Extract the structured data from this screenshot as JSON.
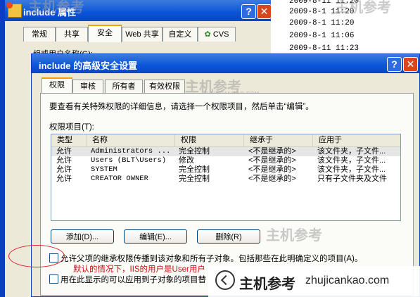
{
  "background_list": {
    "rows": [
      "2009-8-11 11:20",
      "2009-8-1 11:20",
      "2009-8-1 11:20",
      "2009-8-1 11:06",
      "2009-8-11 11:23"
    ]
  },
  "back_window": {
    "title": "include 属性",
    "tabs": [
      "常规",
      "共享",
      "安全",
      "Web 共享",
      "自定义",
      "CVS"
    ],
    "active_tab": "安全",
    "partial_label": "组或用户名称(G):",
    "partial_bottom": "U"
  },
  "front_window": {
    "title": "include 的高级安全设置",
    "tabs": [
      "权限",
      "审核",
      "所有者",
      "有效权限"
    ],
    "active_tab": "权限",
    "description": "要查看有关特殊权限的详细信息，请选择一个权限项目，然后单击“编辑”。",
    "list_label": "权限项目(T):",
    "columns": [
      "类型",
      "名称",
      "权限",
      "继承于",
      "应用于"
    ],
    "rows": [
      {
        "type": "允许",
        "name": "Administrators ...",
        "perm": "完全控制",
        "inherit": "<不是继承的>",
        "apply": "该文件夹，子文件..."
      },
      {
        "type": "允许",
        "name": "Users (BLT\\Users)",
        "perm": "修改",
        "inherit": "<不是继承的>",
        "apply": "该文件夹，子文件..."
      },
      {
        "type": "允许",
        "name": "SYSTEM",
        "perm": "完全控制",
        "inherit": "<不是继承的>",
        "apply": "该文件夹，子文件..."
      },
      {
        "type": "允许",
        "name": "CREATOR OWNER",
        "perm": "完全控制",
        "inherit": "<不是继承的>",
        "apply": "只有子文件夹及文件"
      }
    ],
    "buttons": {
      "add": "添加(D)...",
      "edit": "编辑(E)...",
      "remove": "删除(R)"
    },
    "checkbox_inherit": "允许父项的继承权限传播到该对象和所有子对象。包括那些在此明确定义的项目(A)。",
    "annotation": "默认的情况下，IIS的用户是User用户",
    "checkbox_apply": "用在此显示的可以应用到子对象的项目替"
  },
  "watermark": {
    "zh": "主机参考",
    "en": "zhujicankao.com",
    "small_en": "ZHUJICANKAO.COM"
  }
}
